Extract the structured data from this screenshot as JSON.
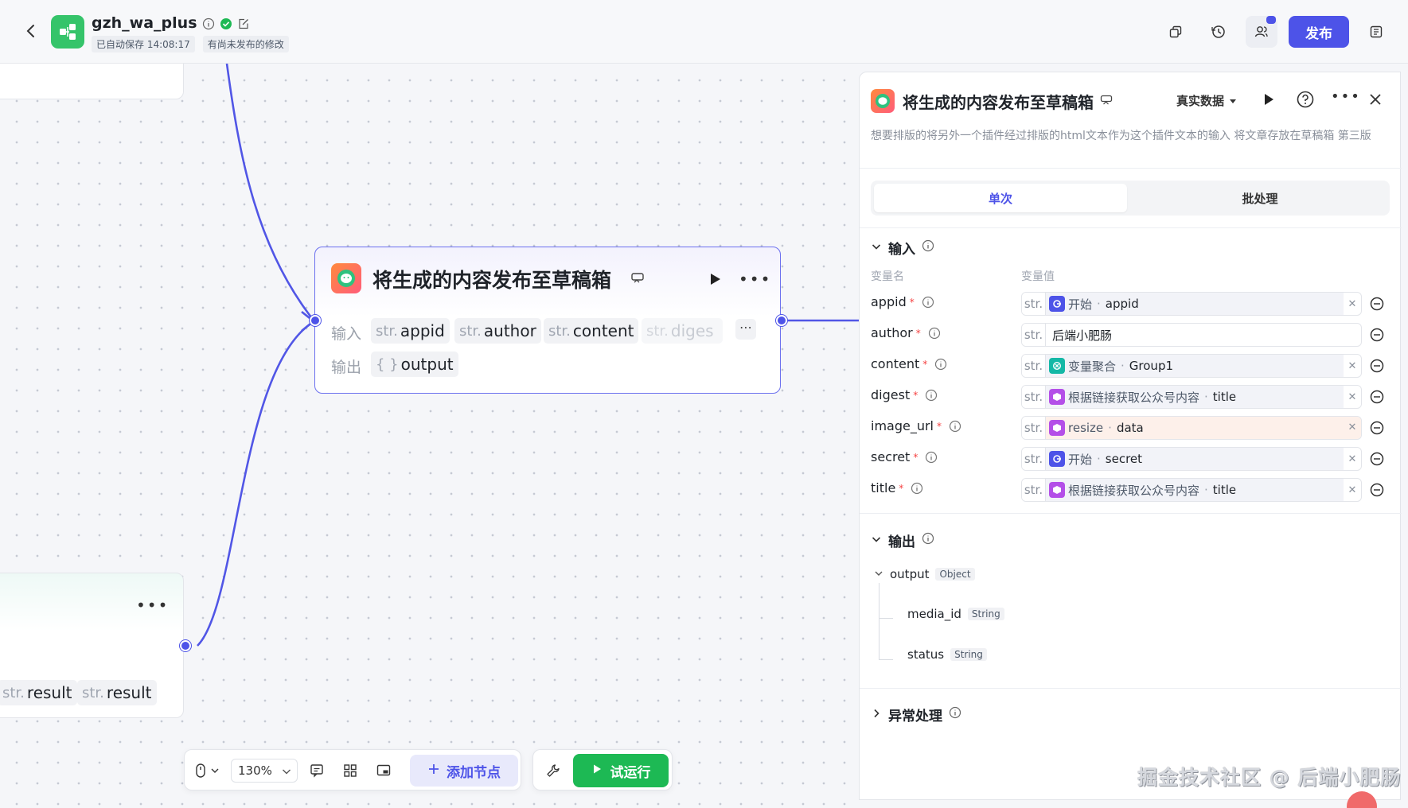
{
  "app": {
    "name": "gzh_wa_plus",
    "autosave": "已自动保存 14:08:17",
    "unpublished": "有尚未发布的修改",
    "publish_label": "发布",
    "accent": "#4d53e8"
  },
  "canvas": {
    "node": {
      "title": "将生成的内容发布至草稿箱",
      "input_label": "输入",
      "output_label": "输出",
      "type_prefix": "str.",
      "obj_prefix": "{ }",
      "inputs": [
        "appid",
        "author",
        "content",
        "diges"
      ],
      "outputs": [
        "output"
      ]
    },
    "bottom_node": {
      "type_prefix": "str.",
      "outputs": [
        "result",
        "result"
      ]
    },
    "toolbar": {
      "zoom": "130%",
      "add_node": "添加节点",
      "test_run": "试运行"
    }
  },
  "panel": {
    "title": "将生成的内容发布至草稿箱",
    "data_mode": "真实数据",
    "description": "想要排版的将另外一个插件经过排版的html文本作为这个插件文本的输入 将文章存放在草稿箱 第三版",
    "tabs": [
      "单次",
      "批处理"
    ],
    "input_section": "输入",
    "col_name": "变量名",
    "col_value": "变量值",
    "type_prefix": "str.",
    "inputs": [
      {
        "name": "appid",
        "kind": "ref",
        "icon": "start",
        "source": "开始",
        "field": "appid"
      },
      {
        "name": "author",
        "kind": "plain",
        "value": "后端小肥肠"
      },
      {
        "name": "content",
        "kind": "ref",
        "icon": "aggregate",
        "source": "变量聚合",
        "field": "Group1"
      },
      {
        "name": "digest",
        "kind": "ref",
        "icon": "plugin",
        "source": "根据链接获取公众号内容",
        "field": "title"
      },
      {
        "name": "image_url",
        "kind": "ref",
        "icon": "plugin",
        "source": "resize",
        "field": "data",
        "warn": true
      },
      {
        "name": "secret",
        "kind": "ref",
        "icon": "start",
        "source": "开始",
        "field": "secret"
      },
      {
        "name": "title",
        "kind": "ref",
        "icon": "plugin",
        "source": "根据链接获取公众号内容",
        "field": "title"
      }
    ],
    "output_section": "输出",
    "outputs": {
      "name": "output",
      "type": "Object",
      "children": [
        {
          "name": "media_id",
          "type": "String"
        },
        {
          "name": "status",
          "type": "String"
        }
      ]
    },
    "error_section": "异常处理"
  },
  "watermark": "掘金技术社区 @ 后端小肥肠"
}
